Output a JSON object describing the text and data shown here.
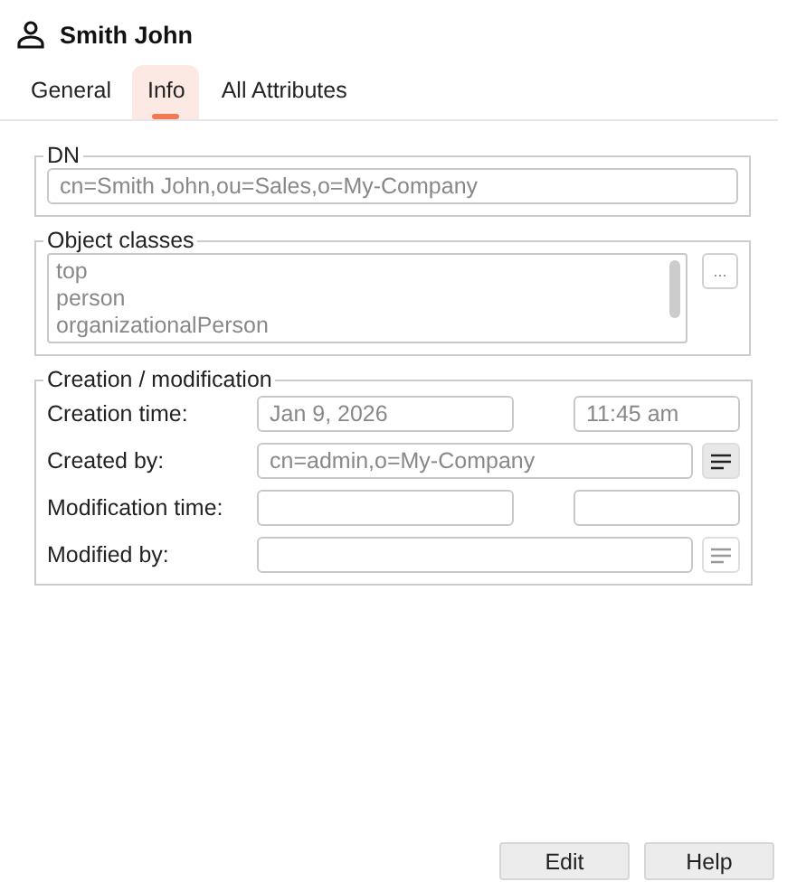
{
  "header": {
    "title": "Smith John"
  },
  "tabs": [
    {
      "label": "General",
      "selected": false
    },
    {
      "label": "Info",
      "selected": true
    },
    {
      "label": "All Attributes",
      "selected": false
    }
  ],
  "dn": {
    "legend": "DN",
    "value": "cn=Smith John,ou=Sales,o=My-Company"
  },
  "object_classes": {
    "legend": "Object classes",
    "items": [
      "top",
      "person",
      "organizationalPerson"
    ],
    "more_button": "..."
  },
  "creation": {
    "legend": "Creation / modification",
    "rows": [
      {
        "kind": "datetime",
        "label": "Creation time:",
        "date": "Jan 9, 2026",
        "time": "11:45 am"
      },
      {
        "kind": "dn",
        "label": "Created by:",
        "value": "cn=admin,o=My-Company",
        "disabled": false
      },
      {
        "kind": "datetime",
        "label": "Modification time:"
      },
      {
        "kind": "dn",
        "label": "Modified by:",
        "disabled": true
      }
    ]
  },
  "buttons": [
    "Edit",
    "Help"
  ]
}
